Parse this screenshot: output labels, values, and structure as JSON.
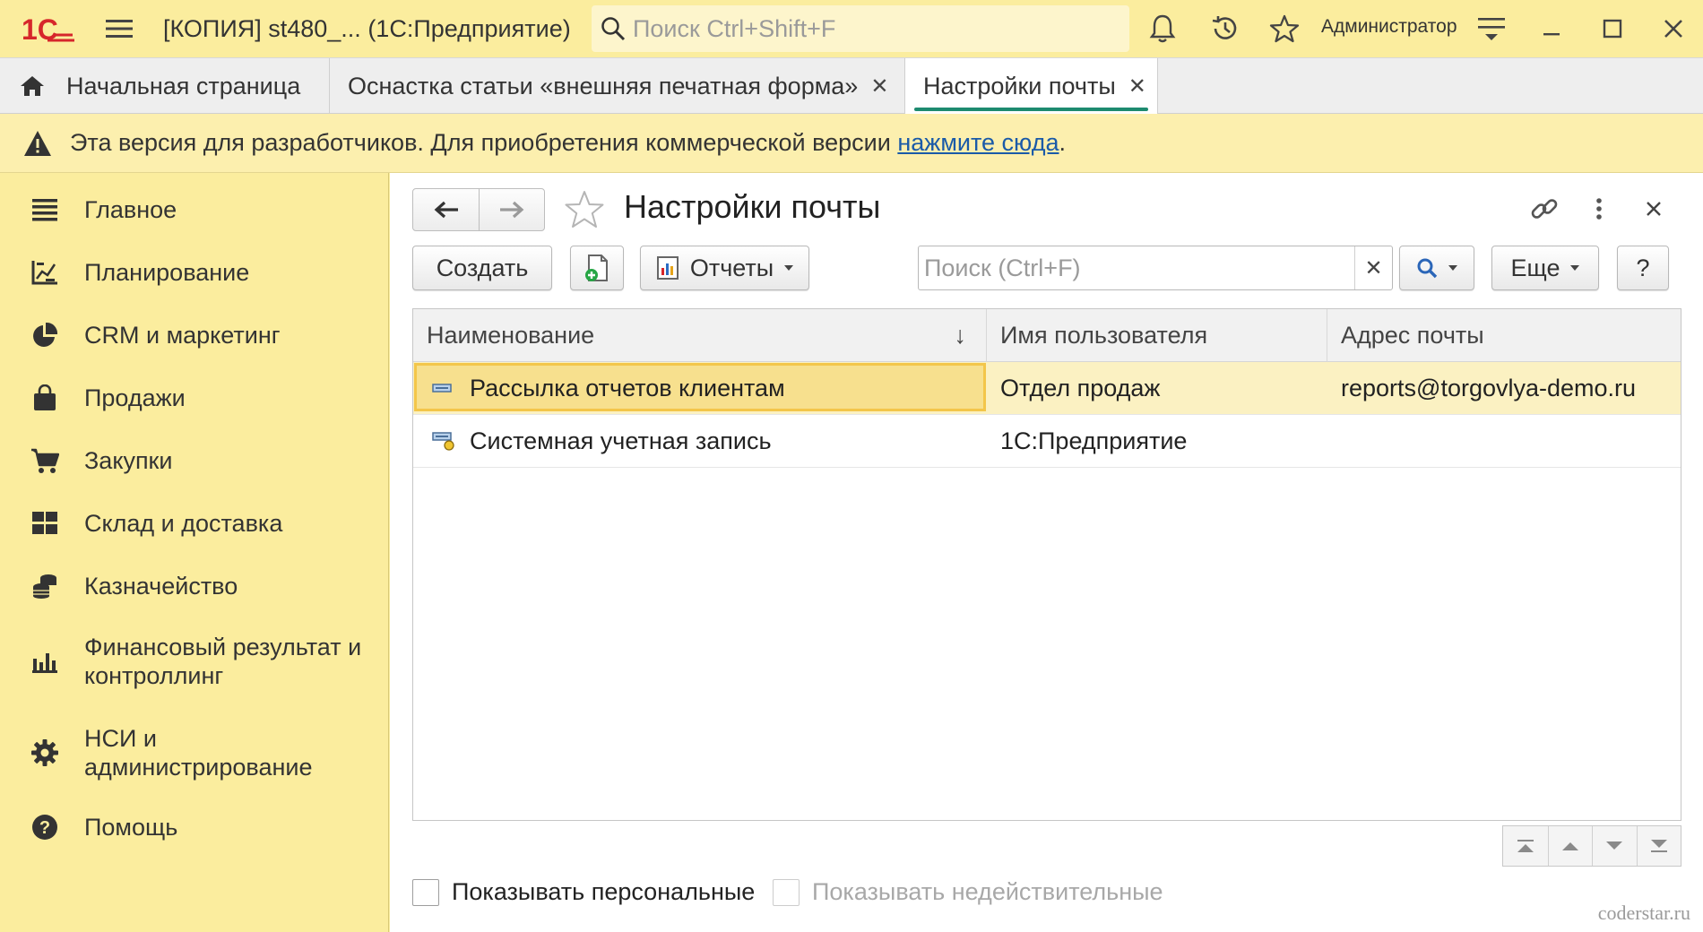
{
  "titlebar": {
    "logo_text": "1С",
    "app_title": "[КОПИЯ] st480_...  (1С:Предприятие)",
    "search_placeholder": "Поиск Ctrl+Shift+F",
    "user_name": "Администратор"
  },
  "tabs": [
    {
      "label": "Начальная страница",
      "icon": "home-icon"
    },
    {
      "label": "Оснастка статьи «внешняя печатная форма»"
    },
    {
      "label": "Настройки почты",
      "active": true
    }
  ],
  "dev_banner": {
    "text": "Эта версия для разработчиков. Для приобретения коммерческой версии ",
    "link": "нажмите сюда",
    "suffix": "."
  },
  "sidebar": {
    "items": [
      {
        "label": "Главное",
        "icon": "list-icon"
      },
      {
        "label": "Планирование",
        "icon": "planning-icon"
      },
      {
        "label": "CRM и маркетинг",
        "icon": "pie-chart-icon"
      },
      {
        "label": "Продажи",
        "icon": "shopping-bag-icon"
      },
      {
        "label": "Закупки",
        "icon": "cart-icon"
      },
      {
        "label": "Склад и доставка",
        "icon": "warehouse-icon"
      },
      {
        "label": "Казначейство",
        "icon": "coins-icon"
      },
      {
        "label": "Финансовый результат и контроллинг",
        "icon": "bar-chart-icon"
      },
      {
        "label": "НСИ и администрирование",
        "icon": "gear-icon"
      },
      {
        "label": "Помощь",
        "icon": "help-icon"
      }
    ]
  },
  "form": {
    "title": "Настройки почты",
    "create_label": "Создать",
    "reports_label": "Отчеты",
    "search_placeholder": "Поиск (Ctrl+F)",
    "more_label": "Еще",
    "help_label": "?"
  },
  "table": {
    "columns": [
      "Наименование",
      "Имя пользователя",
      "Адрес почты"
    ],
    "sort_indicator": "↓",
    "rows": [
      {
        "name": "Рассылка отчетов клиентам",
        "user": "Отдел продаж",
        "email": "reports@torgovlya-demo.ru",
        "selected": true
      },
      {
        "name": "Системная учетная запись",
        "user": "1С:Предприятие",
        "email": ""
      }
    ]
  },
  "checkboxes": {
    "show_personal": "Показывать персональные",
    "show_invalid": "Показывать недействительные"
  },
  "watermark": "coderstar.ru",
  "colors": {
    "panel_yellow": "#fbed9e",
    "selected_row": "#fbf1c2",
    "focus_border": "#f3c64a",
    "active_tab_underline": "#1d8a6f",
    "link_blue": "#1a5aa8",
    "logo_red": "#d6262b"
  }
}
